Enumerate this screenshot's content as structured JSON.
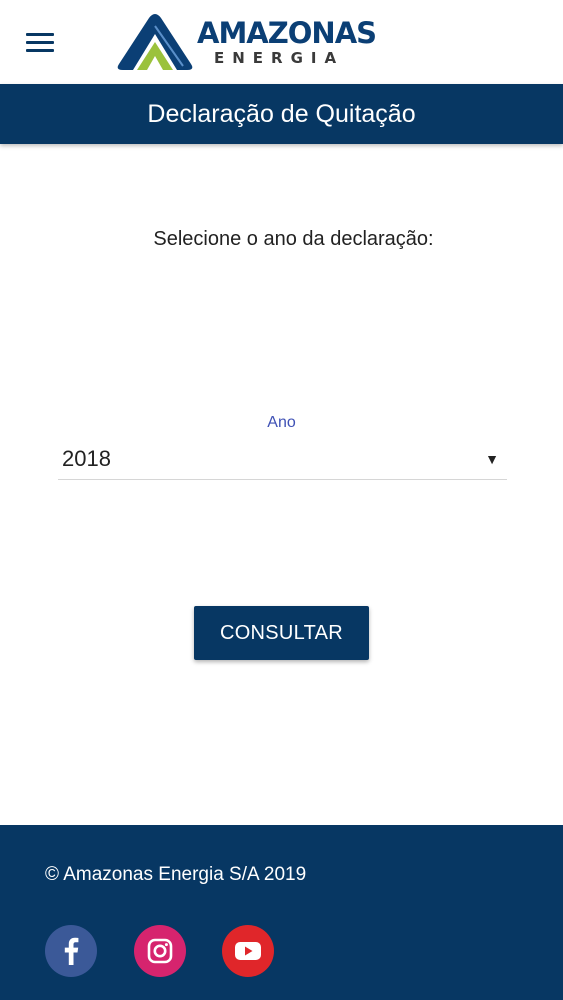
{
  "header": {
    "menu_icon": "hamburger-menu-icon",
    "logo": {
      "word": "AMAZONAS",
      "sub": "ENERGIA",
      "colors": {
        "navy": "#0b3f75",
        "green": "#9bc23c",
        "gray": "#3a3a3a"
      }
    }
  },
  "title_bar": {
    "title": "Declaração de Quitação",
    "background": "#073763"
  },
  "form": {
    "prompt": "Selecione o ano da declaração:",
    "year_label": "Ano",
    "year_value": "2018",
    "dropdown_icon": "triangle-down-icon",
    "submit_label": "CONSULTAR",
    "label_color": "#3f51b5"
  },
  "footer": {
    "copyright": "© Amazonas Energia S/A 2019",
    "background": "#073763",
    "social": [
      {
        "name": "facebook-icon",
        "color": "#3b5998"
      },
      {
        "name": "instagram-icon",
        "color": "#d6246e"
      },
      {
        "name": "youtube-icon",
        "color": "#e0262a"
      }
    ]
  }
}
